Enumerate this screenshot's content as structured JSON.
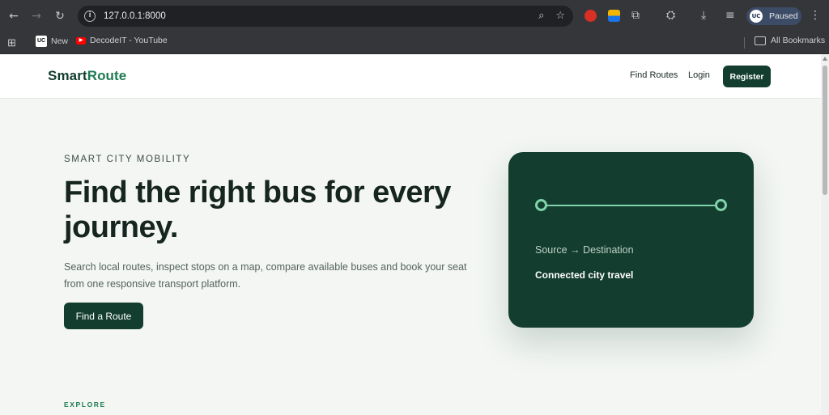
{
  "browser": {
    "url": "127.0.0.1:8000",
    "profile_label": "Paused",
    "bookmarks": [
      {
        "label": "New"
      },
      {
        "label": "DecodeIT - YouTube"
      }
    ],
    "all_bookmarks_label": "All Bookmarks",
    "icons": [
      "back-arrow-icon",
      "forward-arrow-icon",
      "reload-icon",
      "info-icon",
      "zoom-icon",
      "star-icon",
      "extensions-icon",
      "download-icon",
      "menu-icon"
    ]
  },
  "header": {
    "logo_primary": "Smart",
    "logo_accent": "Route",
    "nav": {
      "find_routes": "Find Routes",
      "login": "Login",
      "register": "Register"
    }
  },
  "hero": {
    "eyebrow": "SMART CITY MOBILITY",
    "title": "Find the right bus for every journey.",
    "description": "Search local routes, inspect stops on a map, compare available buses and book your seat from one responsive transport platform.",
    "cta": "Find a Route"
  },
  "card": {
    "subtitle": "Source → Destination",
    "main": "Connected city travel"
  },
  "section": {
    "explore": "EXPLORE"
  },
  "colors": {
    "brand_dark": "#133d2e",
    "brand_accent": "#1e7a54",
    "route_line": "#7fd3aa",
    "page_bg": "#f3f6f3"
  }
}
